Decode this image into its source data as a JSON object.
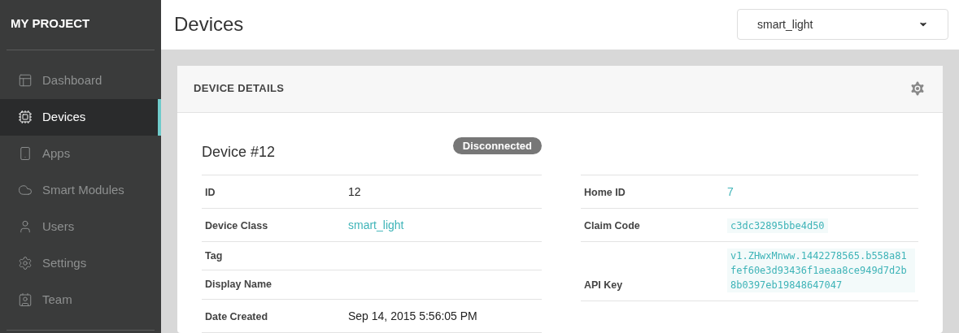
{
  "sidebar": {
    "title": "MY PROJECT",
    "items": [
      {
        "label": "Dashboard",
        "selected": false
      },
      {
        "label": "Devices",
        "selected": true
      },
      {
        "label": "Apps",
        "selected": false
      },
      {
        "label": "Smart Modules",
        "selected": false
      },
      {
        "label": "Users",
        "selected": false
      },
      {
        "label": "Settings",
        "selected": false
      },
      {
        "label": "Team",
        "selected": false
      }
    ]
  },
  "header": {
    "title": "Devices",
    "device_select": {
      "value": "smart_light"
    }
  },
  "card": {
    "title": "DEVICE DETAILS",
    "device_name": "Device #12",
    "status": "Disconnected",
    "left_rows": [
      {
        "label": "ID",
        "value": "12",
        "kind": "plain"
      },
      {
        "label": "Device Class",
        "value": "smart_light",
        "kind": "link"
      },
      {
        "label": "Tag"
      },
      {
        "label": "Display Name"
      },
      {
        "label": "Date Created",
        "value": "Sep 14, 2015 5:56:05 PM",
        "kind": "plain"
      }
    ],
    "right_rows": [
      {
        "label": "Home ID",
        "value": "7",
        "kind": "link"
      },
      {
        "label": "Claim Code",
        "value": "c3dc32895bbe4d50",
        "kind": "code"
      },
      {
        "label": "API Key",
        "value": "v1.ZHwxMnww.1442278565.b558a81fef60e3d93436f1aeaa8ce949d7d2b8b0397eb19848647047",
        "kind": "code"
      }
    ]
  }
}
